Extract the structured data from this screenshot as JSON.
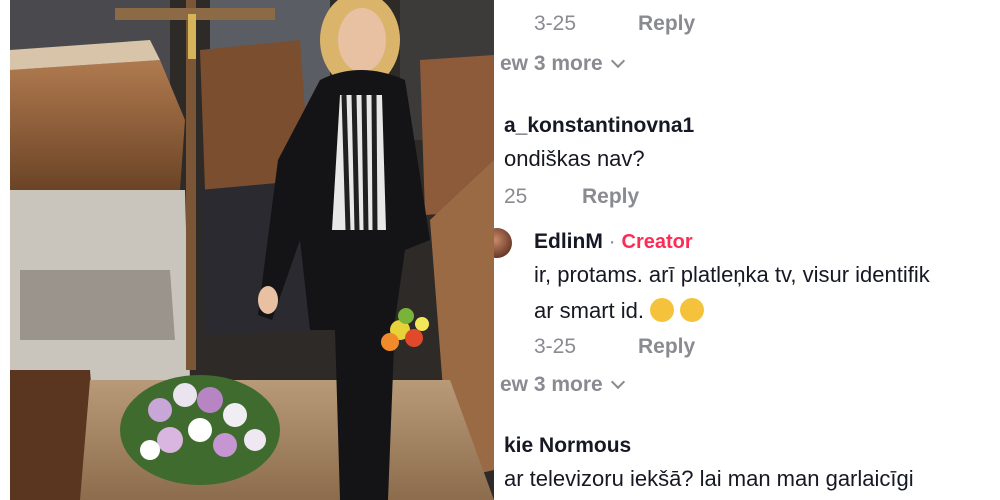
{
  "video": {
    "description": "Woman standing in a coffin showroom next to a crucifix and flowers"
  },
  "comments": {
    "thread": [
      {
        "date": "3-25",
        "reply": "Reply"
      },
      {
        "view_more": "ew 3 more"
      },
      {
        "username": "a_konstantinovna1",
        "text": "ondiškas nav?",
        "date": "25",
        "reply": "Reply"
      },
      {
        "username": "EdlinM",
        "separator": " · ",
        "badge": "Creator",
        "text_line1": "ir, protams. arī platleņka tv, visur identifik",
        "text_line2": "ar smart id.",
        "date": "3-25",
        "reply": "Reply"
      },
      {
        "view_more": "ew 3 more"
      },
      {
        "username": "kie Normous",
        "text": "ar televizoru iekšā? lai man man garlaicīgi"
      }
    ]
  }
}
